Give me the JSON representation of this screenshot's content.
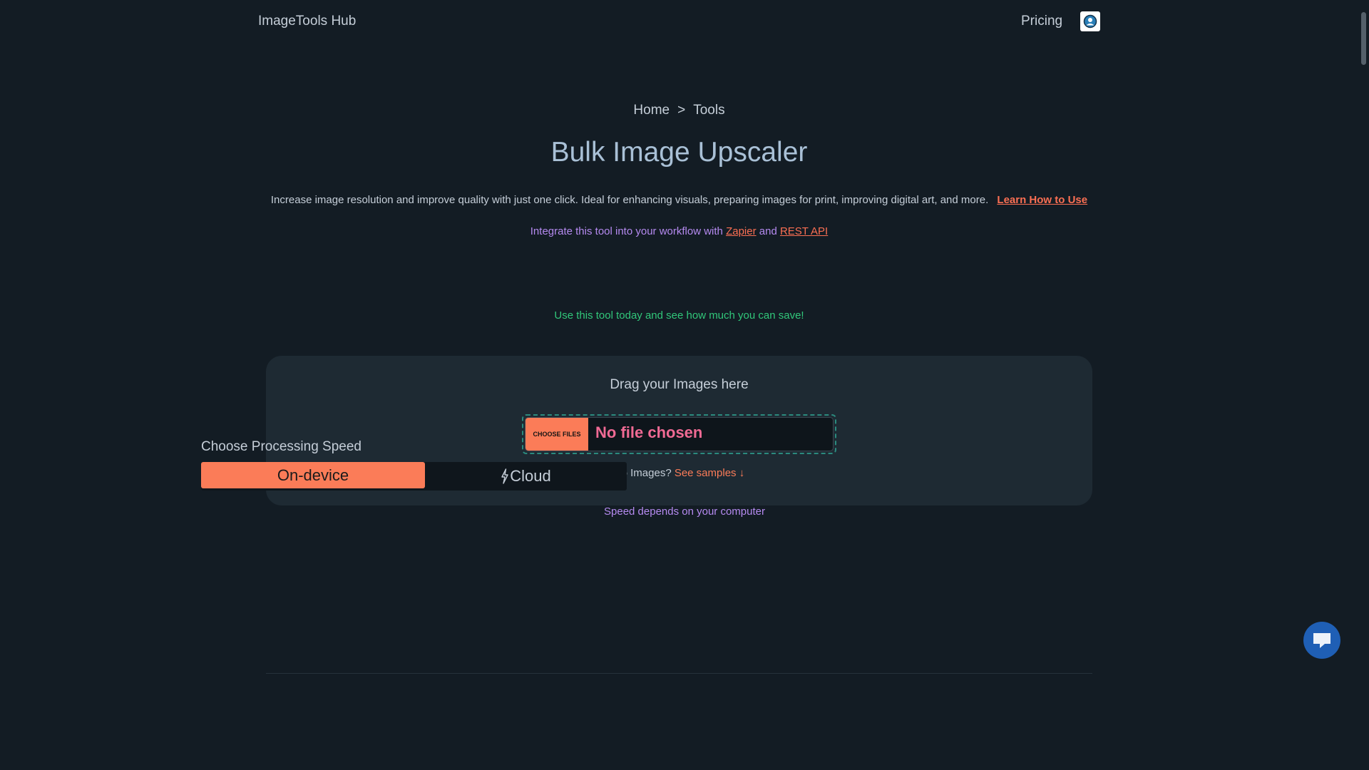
{
  "header": {
    "brand": "ImageTools Hub",
    "pricing": "Pricing",
    "avatar_icon": "user-circle-icon"
  },
  "breadcrumb": {
    "home": "Home",
    "separator": ">",
    "current": "Tools"
  },
  "title": "Bulk Image Upscaler",
  "description": {
    "text": "Increase image resolution and improve quality with just one click. Ideal for enhancing visuals, preparing images for print, improving digital art, and more.",
    "learn_link": "Learn How to Use"
  },
  "integrate": {
    "prefix": "Integrate this tool into your workflow with",
    "zapier": "Zapier",
    "and": "and",
    "rest_api": "REST API"
  },
  "savings": "Use this tool today and see how much you can save!",
  "upload": {
    "drag_text": "Drag your Images here",
    "choose_button": "Choose Files",
    "file_status": "No file chosen",
    "samples_prefix": "No Images?",
    "samples_link": "See samples ↓"
  },
  "speed": {
    "label": "Choose Processing Speed",
    "options": [
      "On-device",
      "Cloud"
    ],
    "selected": "On-device",
    "note": "Speed depends on your computer"
  },
  "colors": {
    "background": "#131c24",
    "accent": "#fb7c58",
    "link": "#fb6f53",
    "purple_text": "#b58af0",
    "green_text": "#31c77a",
    "chat_button": "#1f5fb5"
  },
  "chat": {
    "icon": "chat-bubble-icon"
  }
}
